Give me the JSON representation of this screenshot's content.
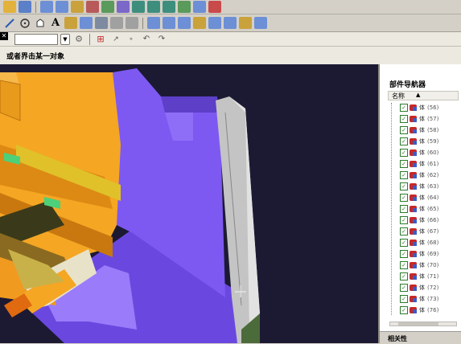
{
  "prompt_bar": {
    "cue_text": "或者界击某一对象",
    "close_glyph": "✕"
  },
  "toolbar_row2": {
    "text_tool": "A"
  },
  "navigator": {
    "title": "部件导航器",
    "column_name": "名称",
    "sort_glyph": "▲",
    "bottom_label": "相关性",
    "rows": [
      {
        "label": "体",
        "num": "(56)"
      },
      {
        "label": "体",
        "num": "(57)"
      },
      {
        "label": "体",
        "num": "(58)"
      },
      {
        "label": "体",
        "num": "(59)"
      },
      {
        "label": "体",
        "num": "(60)"
      },
      {
        "label": "体",
        "num": "(61)"
      },
      {
        "label": "体",
        "num": "(62)"
      },
      {
        "label": "体",
        "num": "(63)"
      },
      {
        "label": "体",
        "num": "(64)"
      },
      {
        "label": "体",
        "num": "(65)"
      },
      {
        "label": "体",
        "num": "(66)"
      },
      {
        "label": "体",
        "num": "(67)"
      },
      {
        "label": "体",
        "num": "(68)"
      },
      {
        "label": "体",
        "num": "(69)"
      },
      {
        "label": "体",
        "num": "(70)"
      },
      {
        "label": "体",
        "num": "(71)"
      },
      {
        "label": "体",
        "num": "(72)"
      },
      {
        "label": "体",
        "num": "(73)"
      },
      {
        "label": "体",
        "num": "(76)"
      }
    ]
  },
  "colors": {
    "viewport_bg": "#1c1a33",
    "orange": "#f59a1c",
    "purple": "#7b57f0",
    "gray_plate": "#c6c6c6",
    "green_face": "#4c6b3a"
  },
  "icons": [
    "feature-icon",
    "sketch-icon",
    "extrude-icon",
    "circle-icon",
    "hole-icon",
    "text-icon",
    "sweep-icon",
    "blend-icon",
    "chamfer-icon",
    "shell-icon",
    "view-icon",
    "render-icon",
    "measure-icon"
  ]
}
